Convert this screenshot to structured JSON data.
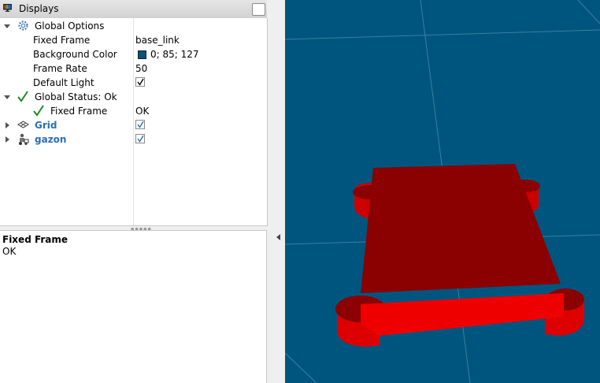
{
  "panel": {
    "title": "Displays"
  },
  "tree": {
    "global_options": {
      "label": "Global Options",
      "fixed_frame": {
        "label": "Fixed Frame",
        "value": "base_link"
      },
      "background_color": {
        "label": "Background Color",
        "value": "0; 85; 127",
        "swatch": "#00557f"
      },
      "frame_rate": {
        "label": "Frame Rate",
        "value": "50"
      },
      "default_light": {
        "label": "Default Light",
        "checked": true
      }
    },
    "global_status": {
      "label": "Global Status: Ok",
      "fixed_frame": {
        "label": "Fixed Frame",
        "value": "OK"
      }
    },
    "grid": {
      "label": "Grid",
      "checked": true
    },
    "gazon": {
      "label": "gazon",
      "checked": true
    }
  },
  "description": {
    "title": "Fixed Frame",
    "body": "OK"
  },
  "colors": {
    "background": "#00557f",
    "grid_line": "#3b7ea1",
    "model_top": "#8b0000",
    "model_side": "#dd0000",
    "accent_label": "#2b6fb4",
    "status_ok": "#1e8a1e"
  }
}
